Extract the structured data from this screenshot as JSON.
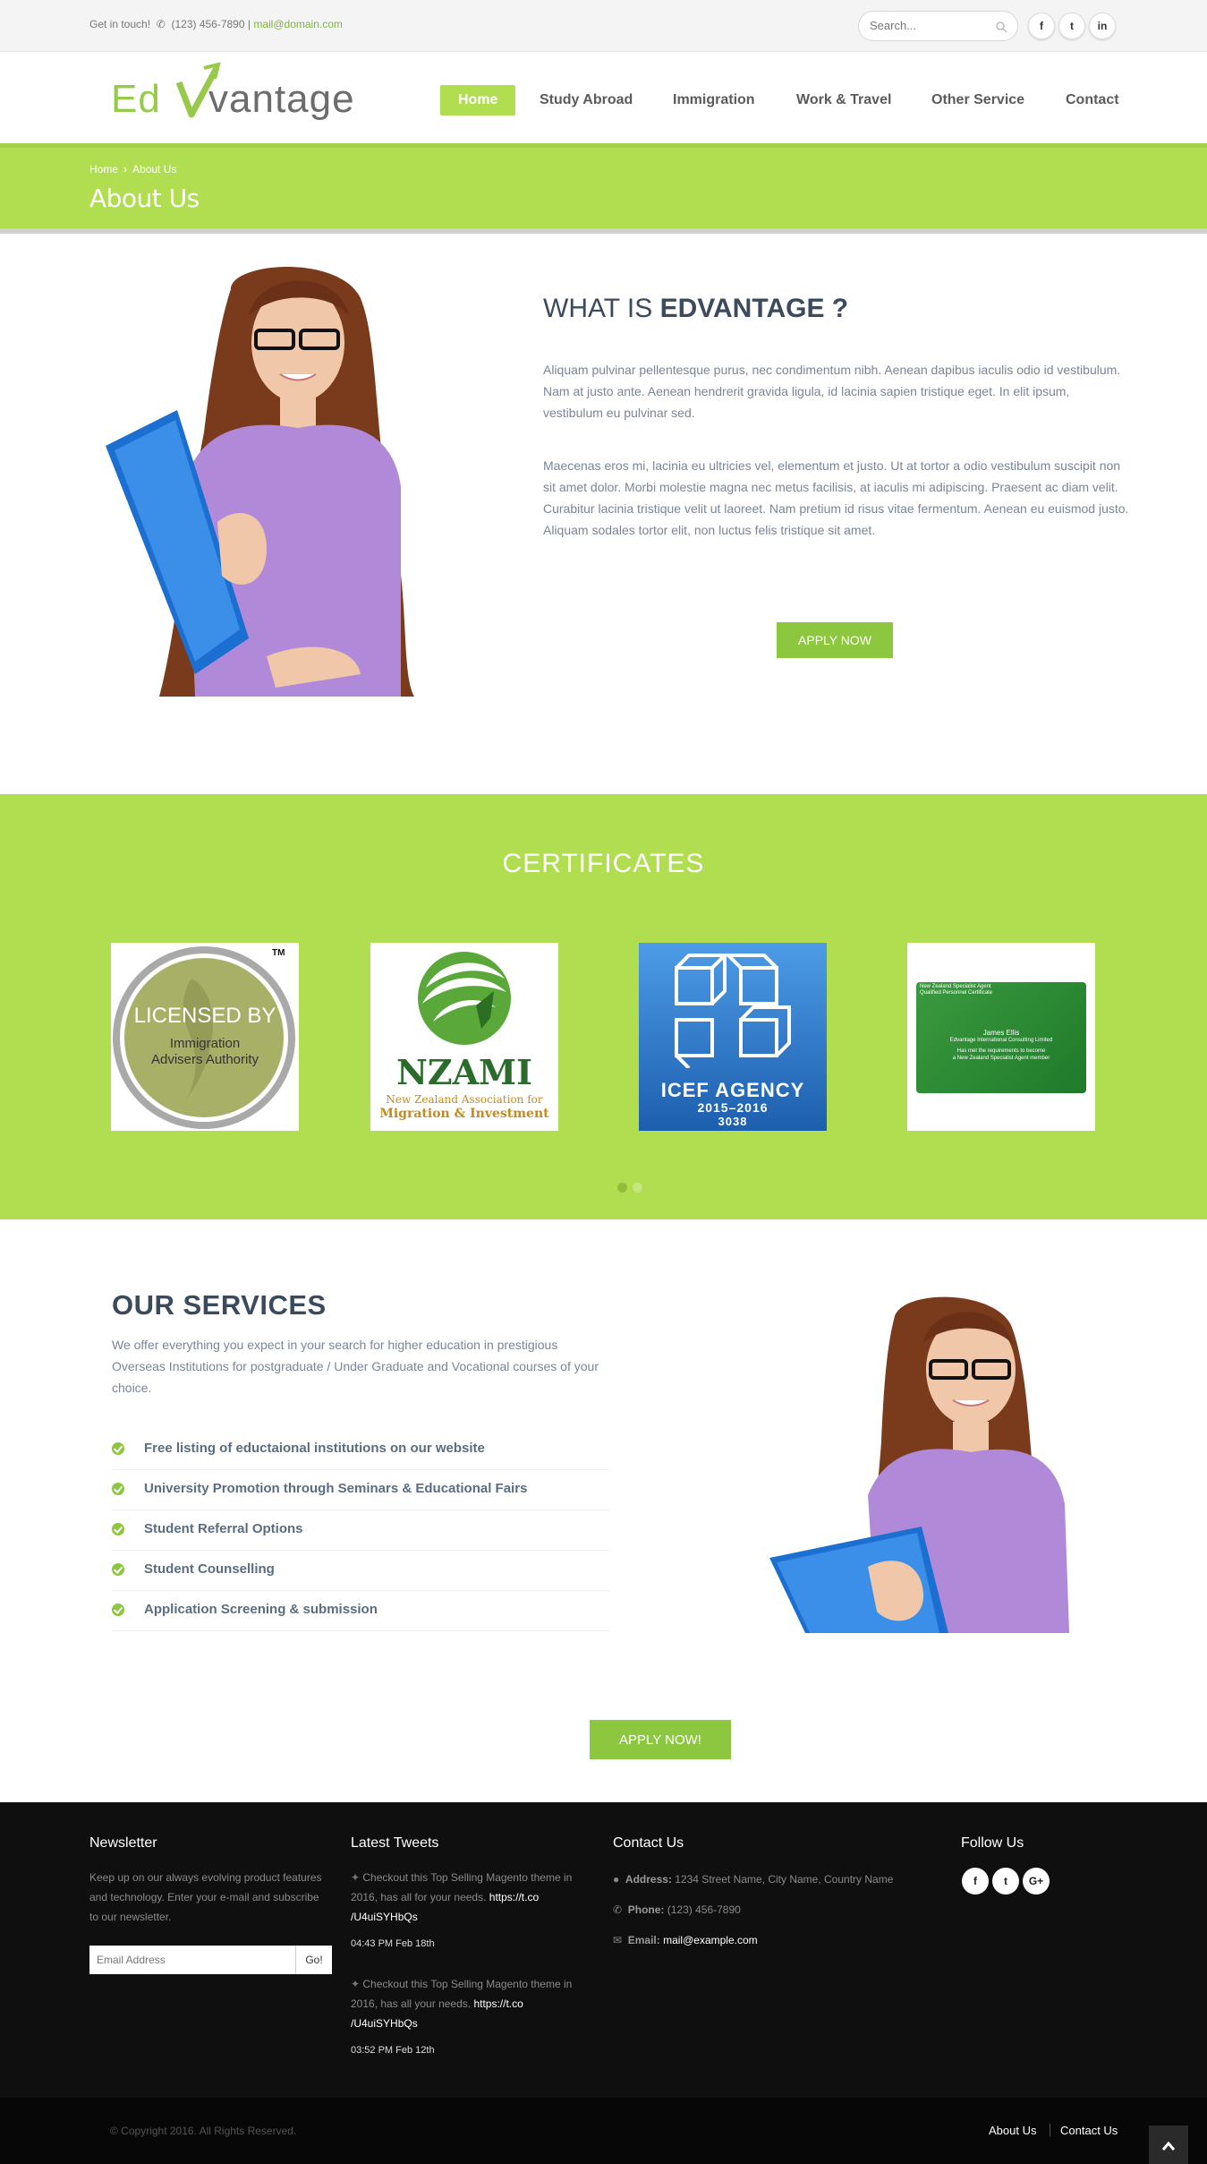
{
  "topbar": {
    "get_in_touch": "Get in touch!",
    "phone": "(123) 456-7890",
    "separator": "|",
    "email": "mail@domain.com",
    "search_placeholder": "Search...",
    "social": [
      "f",
      "t",
      "in"
    ]
  },
  "logo": {
    "part1": "Ed",
    "part2": "vantage"
  },
  "nav": {
    "items": [
      "Home",
      "Study Abroad",
      "Immigration",
      "Work & Travel",
      "Other Service",
      "Contact"
    ],
    "active": "Home"
  },
  "breadcrumb": {
    "home": "Home",
    "current": "About Us"
  },
  "page_title": "About Us",
  "about": {
    "heading_prefix": "WHAT IS ",
    "heading_bold": "EDVANTAGE ?",
    "para1": "Aliquam pulvinar pellentesque purus, nec condimentum nibh. Aenean dapibus iaculis odio id vestibulum. Nam at justo ante. Aenean hendrerit gravida ligula, id lacinia sapien tristique eget. In elit ipsum, vestibulum eu pulvinar sed.",
    "para2": "Maecenas eros mi, lacinia eu ultricies vel, elementum et justo. Ut at tortor a odio vestibulum suscipit non sit amet dolor. Morbi molestie magna nec metus facilisis, at iaculis mi adipiscing. Praesent ac diam velit. Curabitur lacinia tristique velit ut laoreet. Nam pretium id risus vitae fermentum. Aenean eu euismod justo. Aliquam sodales tortor elit, non luctus felis tristique sit amet.",
    "apply_button": "APPLY NOW"
  },
  "certificates": {
    "heading": "CERTIFICATES",
    "iaa": {
      "line1": "LICENSED BY",
      "line2": "Immigration",
      "line3": "Advisers Authority",
      "tm": "TM"
    },
    "nzami": {
      "name": "NZAMI",
      "sub1": "New Zealand Association for",
      "sub2": "Migration & Investment"
    },
    "icef": {
      "name": "ICEF AGENCY",
      "years": "2015–2016",
      "number": "3038"
    },
    "nzsa": {
      "hdr1": "New Zealand Specialist Agent",
      "hdr2": "Qualified Personnel Certificate",
      "person": "James Ellis",
      "company": "Edvantage International Consulting Limited",
      "line1": "Has met the requirements to become",
      "line2": "a New Zealand Specialist Agent member"
    },
    "active_slide": 1,
    "slide_count": 2
  },
  "services": {
    "heading": "OUR SERVICES",
    "intro": "We offer everything you expect in your search for higher education in prestigious Overseas Institutions for postgraduate / Under Graduate and Vocational courses of your choice.",
    "items": [
      "Free listing of eductaional institutions on our website",
      "University Promotion through Seminars & Educational Fairs",
      "Student Referral Options",
      "Student Counselling",
      "Application Screening & submission"
    ],
    "apply_button": "APPLY NOW!"
  },
  "footer": {
    "newsletter": {
      "title": "Newsletter",
      "text": "Keep up on our always evolving product features and technology. Enter your e-mail and subscribe to our newsletter.",
      "placeholder": "Email Address",
      "button": "Go!"
    },
    "tweets": {
      "title": "Latest Tweets",
      "items": [
        {
          "text": "Checkout this Top Selling Magento theme in 2016, has all for your needs.",
          "link1": "https://t.co",
          "link2": "/U4uiSYHbQs",
          "time": "04:43 PM Feb 18th"
        },
        {
          "text": "Checkout this Top Selling Magento theme in 2016, has all your needs.",
          "link1": "https://t.co",
          "link2": "/U4uiSYHbQs",
          "time": "03:52 PM Feb 12th"
        }
      ]
    },
    "contact": {
      "title": "Contact Us",
      "address_label": "Address:",
      "address": "1234 Street Name, City Name, Country Name",
      "phone_label": "Phone:",
      "phone": "(123) 456-7890",
      "email_label": "Email:",
      "email": "mail@example.com"
    },
    "follow": {
      "title": "Follow Us",
      "social": [
        "f",
        "t",
        "G+"
      ]
    },
    "copyright": "© Copyright 2016. All Rights Reserved.",
    "links": [
      "About Us",
      "Contact Us"
    ]
  },
  "colors": {
    "accent": "#b1dd50",
    "button": "#8dc63f",
    "heading": "#3c4b5c",
    "footer_bg": "#0f0f0f"
  }
}
